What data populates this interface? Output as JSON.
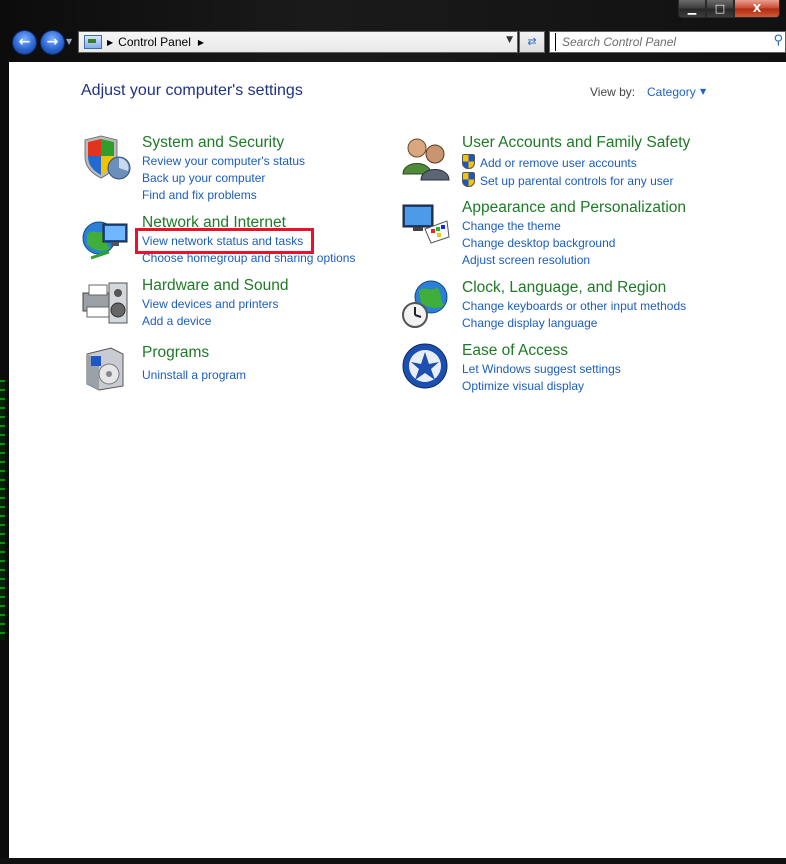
{
  "window": {
    "caption_buttons": {
      "minimize": "▁",
      "maximize": "□",
      "close": "X"
    }
  },
  "nav": {
    "back_icon": "left-arrow-icon",
    "forward_icon": "right-arrow-icon",
    "breadcrumb": [
      "Control Panel"
    ],
    "search_placeholder": "Search Control Panel"
  },
  "main": {
    "title": "Adjust your computer's settings",
    "view_by_label": "View by:",
    "view_by_value": "Category",
    "categories": [
      {
        "title": "System and Security",
        "icon": "shield-icon",
        "links": [
          "Review your computer's status",
          "Back up your computer",
          "Find and fix problems"
        ]
      },
      {
        "title": "Network and Internet",
        "icon": "network-globe-icon",
        "links": [
          "View network status and tasks",
          "Choose homegroup and sharing options"
        ]
      },
      {
        "title": "Hardware and Sound",
        "icon": "printer-speaker-icon",
        "links": [
          "View devices and printers",
          "Add a device"
        ]
      },
      {
        "title": "Programs",
        "icon": "programs-box-icon",
        "links": [
          "Uninstall a program"
        ]
      },
      {
        "title": "User Accounts and Family Safety",
        "icon": "users-icon",
        "links": [
          "Add or remove user accounts",
          "Set up parental controls for any user"
        ]
      },
      {
        "title": "Appearance and Personalization",
        "icon": "monitor-palette-icon",
        "links": [
          "Change the theme",
          "Change desktop background",
          "Adjust screen resolution"
        ]
      },
      {
        "title": "Clock, Language, and Region",
        "icon": "clock-globe-icon",
        "links": [
          "Change keyboards or other input methods",
          "Change display language"
        ]
      },
      {
        "title": "Ease of Access",
        "icon": "ease-of-access-icon",
        "links": [
          "Let Windows suggest settings",
          "Optimize visual display"
        ]
      }
    ]
  },
  "colors": {
    "title": "#1e3287",
    "category": "#1e7a26",
    "link": "#1b5dc2",
    "highlight": "#e8132b"
  }
}
